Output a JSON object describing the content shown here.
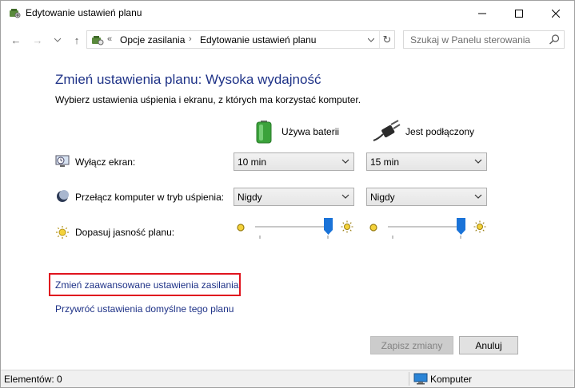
{
  "window": {
    "title": "Edytowanie ustawień planu",
    "minimize": "—",
    "maximize": "☐",
    "close": "✕"
  },
  "nav": {
    "back": "←",
    "forward": "→",
    "recent": "⌄",
    "up": "↑",
    "breadcrumb_chevron": "«",
    "breadcrumb": [
      "Opcje zasilania",
      "Edytowanie ustawień planu"
    ],
    "breadcrumb_separator": "›",
    "address_dropdown": "⌄",
    "refresh": "↻",
    "search_placeholder": "Szukaj w Panelu sterowania"
  },
  "content": {
    "heading": "Zmień ustawienia planu: Wysoka wydajność",
    "subtitle": "Wybierz ustawienia uśpienia i ekranu, z których ma korzystać komputer.",
    "columns": {
      "battery": "Używa baterii",
      "plugged": "Jest podłączony"
    },
    "rows": {
      "display_off": {
        "label": "Wyłącz ekran:",
        "battery_value": "10 min",
        "plugged_value": "15 min"
      },
      "sleep": {
        "label": "Przełącz komputer w tryb uśpienia:",
        "battery_value": "Nigdy",
        "plugged_value": "Nigdy"
      },
      "brightness": {
        "label": "Dopasuj jasność planu:",
        "battery_level": 1.0,
        "plugged_level": 1.0
      }
    },
    "links": {
      "advanced": "Zmień zaawansowane ustawienia zasilania",
      "restore": "Przywróć ustawienia domyślne tego planu"
    },
    "buttons": {
      "save": "Zapisz zmiany",
      "cancel": "Anuluj"
    },
    "colors": {
      "link": "#1e3287",
      "highlight": "#e0141e",
      "slider_thumb": "#1a73d8"
    }
  },
  "status": {
    "items": "Elementów: 0",
    "location": "Komputer"
  }
}
